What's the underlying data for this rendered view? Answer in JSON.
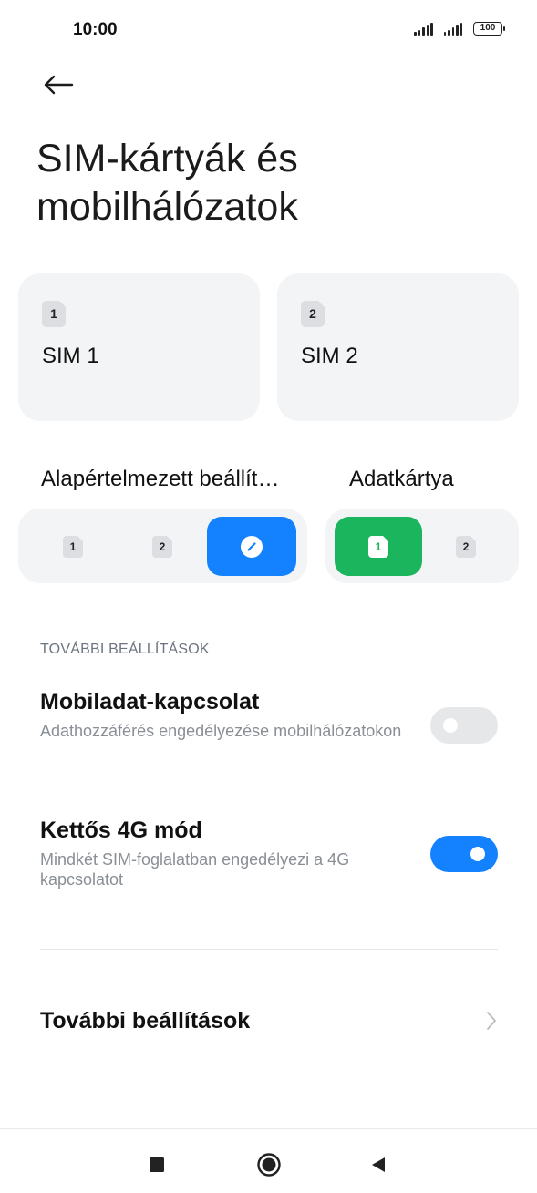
{
  "status_bar": {
    "time": "10:00",
    "battery_level": "100",
    "icons": [
      "signal-icon-sim1",
      "signal-icon-sim2",
      "battery-icon"
    ]
  },
  "header": {
    "back_icon": "arrow-left-icon",
    "title": "SIM-kártyák és mobilhálózatok"
  },
  "sim_cards": [
    {
      "number": "1",
      "label": "SIM 1"
    },
    {
      "number": "2",
      "label": "SIM 2"
    }
  ],
  "defaults": {
    "label": "Alapértelmezett beállít…",
    "options": [
      "1",
      "2"
    ],
    "selected_icon": "edit-icon",
    "accent_color": "#1482ff"
  },
  "data_card": {
    "label": "Adatkártya",
    "options": [
      "1",
      "2"
    ],
    "selected": "1",
    "accent_color": "#1ab55c"
  },
  "more_settings_header": "TOVÁBBI BEÁLLÍTÁSOK",
  "mobile_data": {
    "title": "Mobiladat-kapcsolat",
    "subtitle": "Adathozzáférés engedélyezése mobilhálózatokon",
    "enabled": false
  },
  "dual_4g": {
    "title": "Kettős 4G mód",
    "subtitle": "Mindkét SIM-foglalatban engedélyezi a 4G kapcsolatot",
    "enabled": true
  },
  "more_settings_link": {
    "label": "További beállítások",
    "icon": "chevron-right-icon"
  },
  "nav_bar": {
    "buttons": [
      "recents-square-icon",
      "home-circle-icon",
      "back-triangle-icon"
    ]
  }
}
